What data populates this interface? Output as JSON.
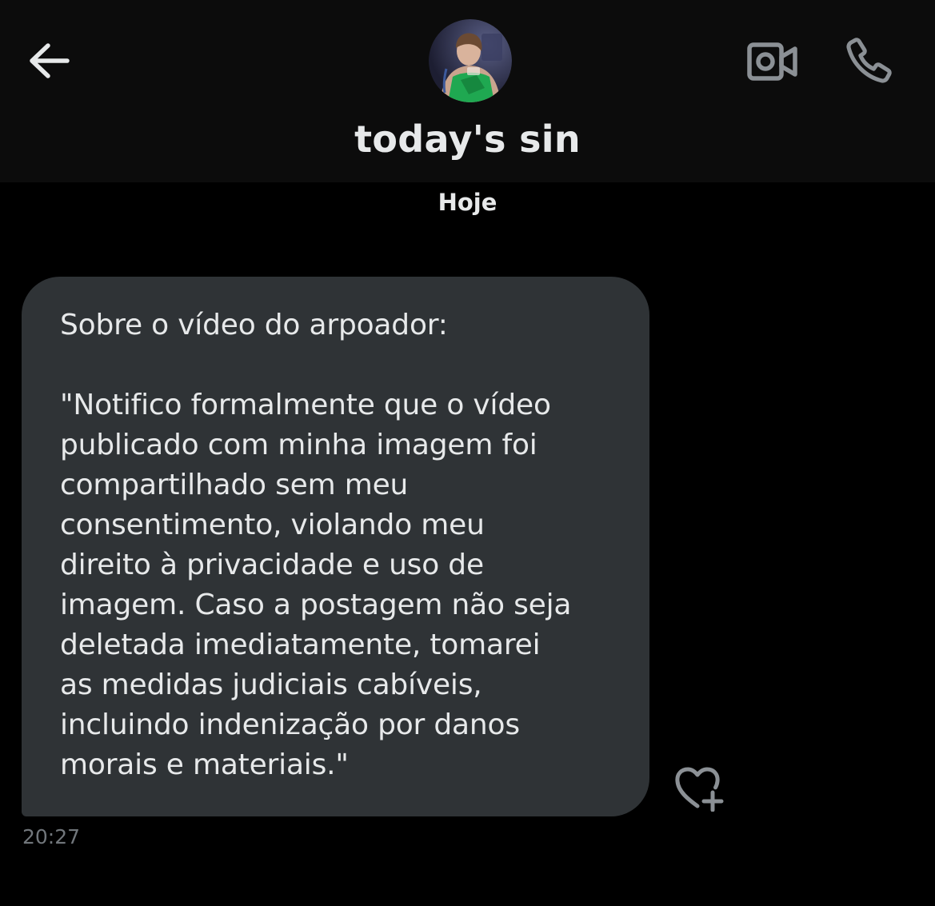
{
  "header": {
    "back_icon": "arrow-left-icon",
    "avatar_alt": "today's sin",
    "contact_name": "today's sin",
    "video_icon": "video-camera-icon",
    "call_icon": "phone-icon"
  },
  "conversation": {
    "day_label": "Hoje",
    "messages": [
      {
        "text": "Sobre o vídeo do arpoador:\n\n\"Notifico formalmente que o vídeo\npublicado com minha imagem foi\ncompartilhado sem meu\nconsentimento, violando meu\ndireito à privacidade e uso de\nimagem. Caso a postagem não seja\ndeletada imediatamente, tomarei\nas medidas judiciais cabíveis,\nincluindo indenização por danos\nmorais e materiais.\"",
        "time": "20:27",
        "reaction_icon": "heart-plus-icon"
      }
    ]
  },
  "colors": {
    "background": "#000000",
    "header_bg": "#0c0c0c",
    "bubble_bg": "#2f3336",
    "text": "#e7e9ea",
    "muted": "#71767b"
  }
}
